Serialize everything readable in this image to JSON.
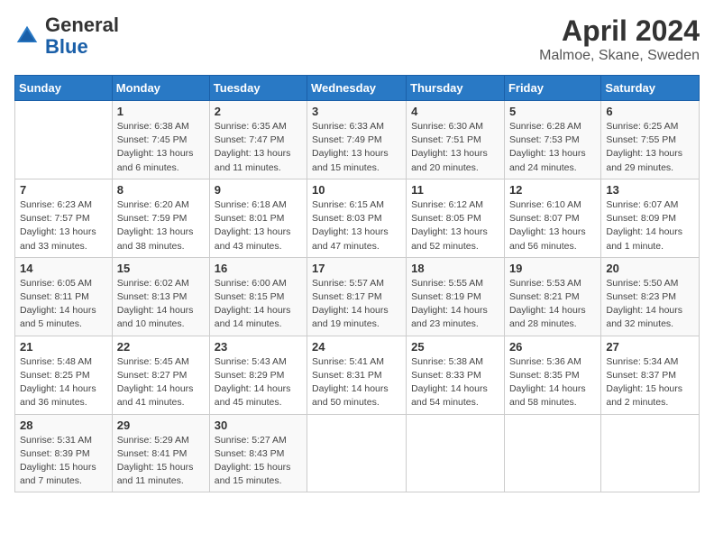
{
  "header": {
    "logo": {
      "general": "General",
      "blue": "Blue"
    },
    "title": "April 2024",
    "location": "Malmoe, Skane, Sweden"
  },
  "days_of_week": [
    "Sunday",
    "Monday",
    "Tuesday",
    "Wednesday",
    "Thursday",
    "Friday",
    "Saturday"
  ],
  "weeks": [
    [
      {
        "day": "",
        "info": ""
      },
      {
        "day": "1",
        "info": "Sunrise: 6:38 AM\nSunset: 7:45 PM\nDaylight: 13 hours\nand 6 minutes."
      },
      {
        "day": "2",
        "info": "Sunrise: 6:35 AM\nSunset: 7:47 PM\nDaylight: 13 hours\nand 11 minutes."
      },
      {
        "day": "3",
        "info": "Sunrise: 6:33 AM\nSunset: 7:49 PM\nDaylight: 13 hours\nand 15 minutes."
      },
      {
        "day": "4",
        "info": "Sunrise: 6:30 AM\nSunset: 7:51 PM\nDaylight: 13 hours\nand 20 minutes."
      },
      {
        "day": "5",
        "info": "Sunrise: 6:28 AM\nSunset: 7:53 PM\nDaylight: 13 hours\nand 24 minutes."
      },
      {
        "day": "6",
        "info": "Sunrise: 6:25 AM\nSunset: 7:55 PM\nDaylight: 13 hours\nand 29 minutes."
      }
    ],
    [
      {
        "day": "7",
        "info": "Sunrise: 6:23 AM\nSunset: 7:57 PM\nDaylight: 13 hours\nand 33 minutes."
      },
      {
        "day": "8",
        "info": "Sunrise: 6:20 AM\nSunset: 7:59 PM\nDaylight: 13 hours\nand 38 minutes."
      },
      {
        "day": "9",
        "info": "Sunrise: 6:18 AM\nSunset: 8:01 PM\nDaylight: 13 hours\nand 43 minutes."
      },
      {
        "day": "10",
        "info": "Sunrise: 6:15 AM\nSunset: 8:03 PM\nDaylight: 13 hours\nand 47 minutes."
      },
      {
        "day": "11",
        "info": "Sunrise: 6:12 AM\nSunset: 8:05 PM\nDaylight: 13 hours\nand 52 minutes."
      },
      {
        "day": "12",
        "info": "Sunrise: 6:10 AM\nSunset: 8:07 PM\nDaylight: 13 hours\nand 56 minutes."
      },
      {
        "day": "13",
        "info": "Sunrise: 6:07 AM\nSunset: 8:09 PM\nDaylight: 14 hours\nand 1 minute."
      }
    ],
    [
      {
        "day": "14",
        "info": "Sunrise: 6:05 AM\nSunset: 8:11 PM\nDaylight: 14 hours\nand 5 minutes."
      },
      {
        "day": "15",
        "info": "Sunrise: 6:02 AM\nSunset: 8:13 PM\nDaylight: 14 hours\nand 10 minutes."
      },
      {
        "day": "16",
        "info": "Sunrise: 6:00 AM\nSunset: 8:15 PM\nDaylight: 14 hours\nand 14 minutes."
      },
      {
        "day": "17",
        "info": "Sunrise: 5:57 AM\nSunset: 8:17 PM\nDaylight: 14 hours\nand 19 minutes."
      },
      {
        "day": "18",
        "info": "Sunrise: 5:55 AM\nSunset: 8:19 PM\nDaylight: 14 hours\nand 23 minutes."
      },
      {
        "day": "19",
        "info": "Sunrise: 5:53 AM\nSunset: 8:21 PM\nDaylight: 14 hours\nand 28 minutes."
      },
      {
        "day": "20",
        "info": "Sunrise: 5:50 AM\nSunset: 8:23 PM\nDaylight: 14 hours\nand 32 minutes."
      }
    ],
    [
      {
        "day": "21",
        "info": "Sunrise: 5:48 AM\nSunset: 8:25 PM\nDaylight: 14 hours\nand 36 minutes."
      },
      {
        "day": "22",
        "info": "Sunrise: 5:45 AM\nSunset: 8:27 PM\nDaylight: 14 hours\nand 41 minutes."
      },
      {
        "day": "23",
        "info": "Sunrise: 5:43 AM\nSunset: 8:29 PM\nDaylight: 14 hours\nand 45 minutes."
      },
      {
        "day": "24",
        "info": "Sunrise: 5:41 AM\nSunset: 8:31 PM\nDaylight: 14 hours\nand 50 minutes."
      },
      {
        "day": "25",
        "info": "Sunrise: 5:38 AM\nSunset: 8:33 PM\nDaylight: 14 hours\nand 54 minutes."
      },
      {
        "day": "26",
        "info": "Sunrise: 5:36 AM\nSunset: 8:35 PM\nDaylight: 14 hours\nand 58 minutes."
      },
      {
        "day": "27",
        "info": "Sunrise: 5:34 AM\nSunset: 8:37 PM\nDaylight: 15 hours\nand 2 minutes."
      }
    ],
    [
      {
        "day": "28",
        "info": "Sunrise: 5:31 AM\nSunset: 8:39 PM\nDaylight: 15 hours\nand 7 minutes."
      },
      {
        "day": "29",
        "info": "Sunrise: 5:29 AM\nSunset: 8:41 PM\nDaylight: 15 hours\nand 11 minutes."
      },
      {
        "day": "30",
        "info": "Sunrise: 5:27 AM\nSunset: 8:43 PM\nDaylight: 15 hours\nand 15 minutes."
      },
      {
        "day": "",
        "info": ""
      },
      {
        "day": "",
        "info": ""
      },
      {
        "day": "",
        "info": ""
      },
      {
        "day": "",
        "info": ""
      }
    ]
  ]
}
